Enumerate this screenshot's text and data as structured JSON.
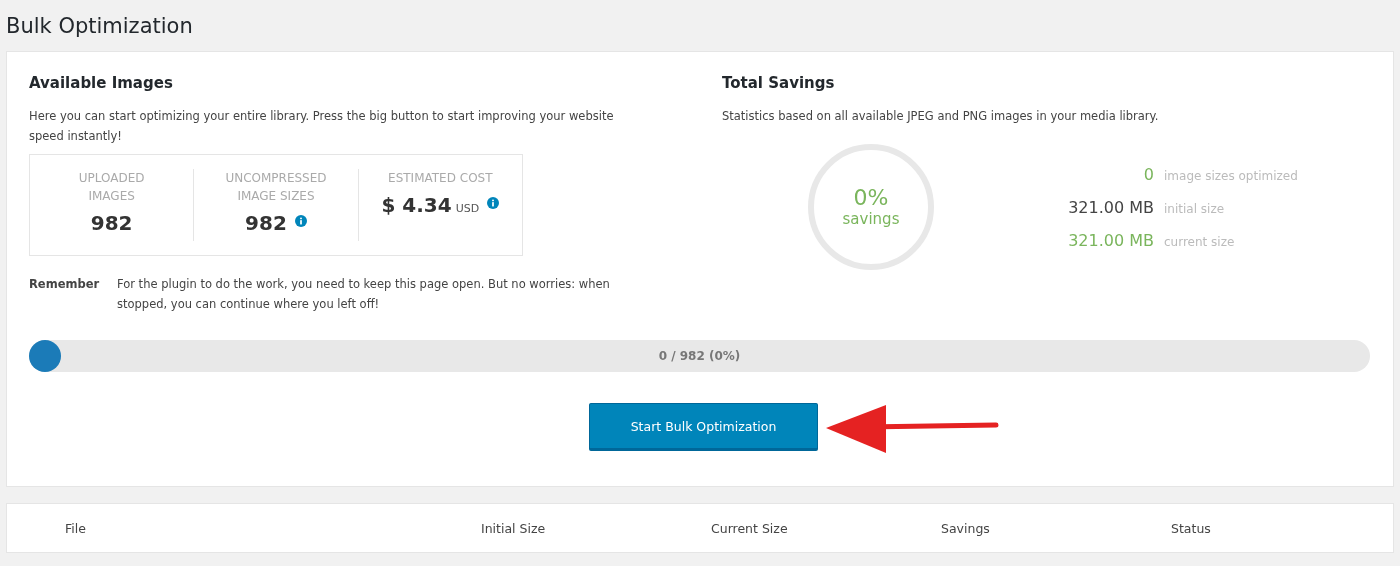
{
  "page_title": "Bulk Optimization",
  "available": {
    "heading": "Available Images",
    "description": "Here you can start optimizing your entire library. Press the big button to start improving your website speed instantly!",
    "stats": [
      {
        "label": "UPLOADED IMAGES",
        "value": "982",
        "info": false
      },
      {
        "label": "UNCOMPRESSED IMAGE SIZES",
        "value": "982",
        "info": true
      },
      {
        "label": "ESTIMATED COST",
        "value": "$ 4.34",
        "unit": "USD",
        "info": true
      }
    ],
    "remember_label": "Remember",
    "remember_text": "For the plugin to do the work, you need to keep this page open. But no worries: when stopped, you can continue where you left off!"
  },
  "savings": {
    "heading": "Total Savings",
    "description": "Statistics based on all available JPEG and PNG images in your media library.",
    "percent": "0%",
    "percent_label": "savings",
    "figures": [
      {
        "value": "0",
        "label": "image sizes optimized",
        "color": "#7ab55c"
      },
      {
        "value": "321.00 MB",
        "label": "initial size",
        "color": "#444444"
      },
      {
        "value": "321.00 MB",
        "label": "current size",
        "color": "#7ab55c"
      }
    ]
  },
  "progress": {
    "level": 0,
    "text": "0 / 982 (0%)"
  },
  "start_button": "Start Bulk Optimization",
  "table": {
    "columns": [
      "File",
      "Initial Size",
      "Current Size",
      "Savings",
      "Status"
    ]
  }
}
